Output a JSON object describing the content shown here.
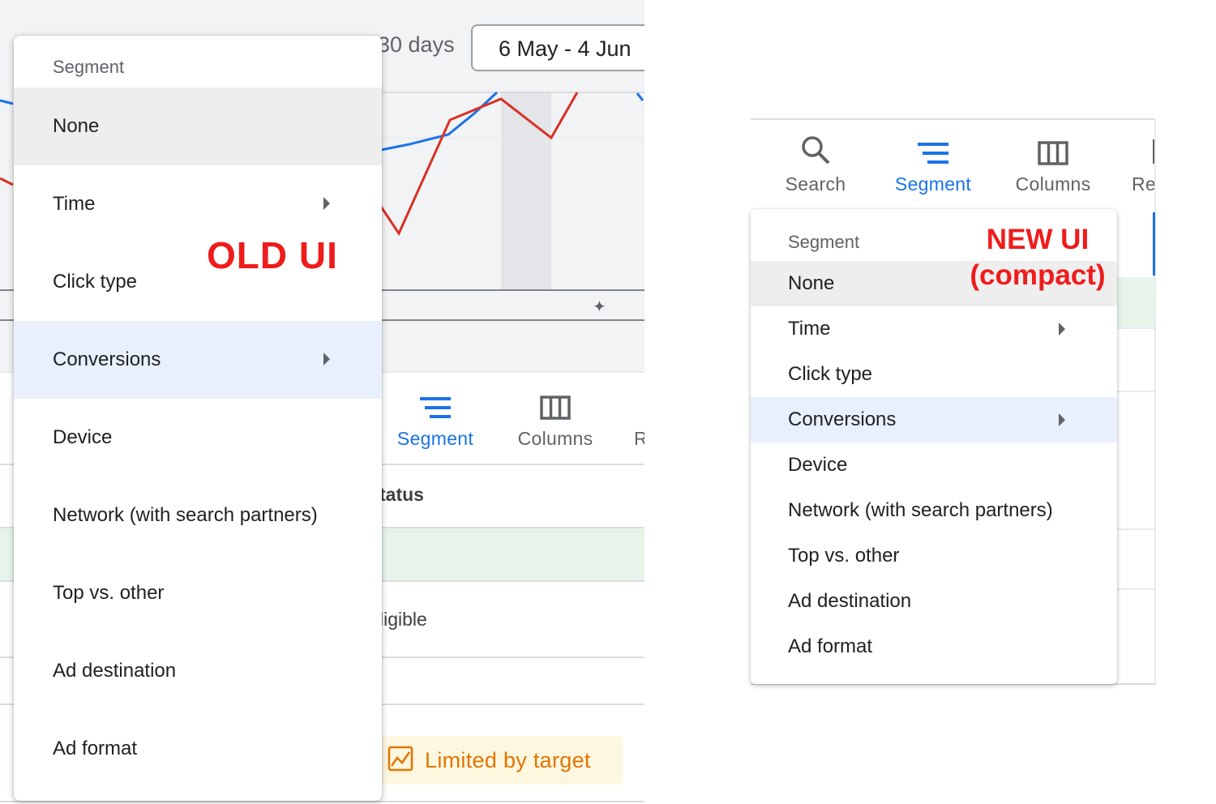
{
  "old_ui": {
    "annotation": "OLD UI",
    "date_range": {
      "label": "30 days",
      "value": "6 May - 4 Jun"
    },
    "toolbar": {
      "segment": "Segment",
      "columns": "Columns",
      "reports_partial": "R"
    },
    "table": {
      "status_header": "tatus",
      "eligible": "ligible",
      "limited_by_target": "Limited by target"
    },
    "menu": {
      "title": "Segment",
      "items": [
        {
          "label": "None",
          "state": "selected"
        },
        {
          "label": "Time",
          "submenu": true
        },
        {
          "label": "Click type"
        },
        {
          "label": "Conversions",
          "state": "highlighted",
          "submenu": true
        },
        {
          "label": "Device"
        },
        {
          "label": "Network (with search partners)"
        },
        {
          "label": "Top vs. other"
        },
        {
          "label": "Ad destination"
        },
        {
          "label": "Ad format"
        }
      ]
    },
    "chart_colors": {
      "series_blue": "#1a73e8",
      "series_red": "#d93025"
    }
  },
  "new_ui": {
    "annotation_line1": "NEW UI",
    "annotation_line2": "(compact)",
    "toolbar": {
      "search": "Search",
      "segment": "Segment",
      "columns": "Columns",
      "reports_partial": "Re"
    },
    "menu": {
      "title": "Segment",
      "items": [
        {
          "label": "None",
          "state": "selected"
        },
        {
          "label": "Time",
          "submenu": true
        },
        {
          "label": "Click type"
        },
        {
          "label": "Conversions",
          "state": "highlighted",
          "submenu": true
        },
        {
          "label": "Device"
        },
        {
          "label": "Network (with search partners)"
        },
        {
          "label": "Top vs. other"
        },
        {
          "label": "Ad destination"
        },
        {
          "label": "Ad format"
        }
      ]
    }
  },
  "colors": {
    "accent": "#1a73e8",
    "annotation_red": "#ee1c1c",
    "warning_orange": "#e37400"
  }
}
